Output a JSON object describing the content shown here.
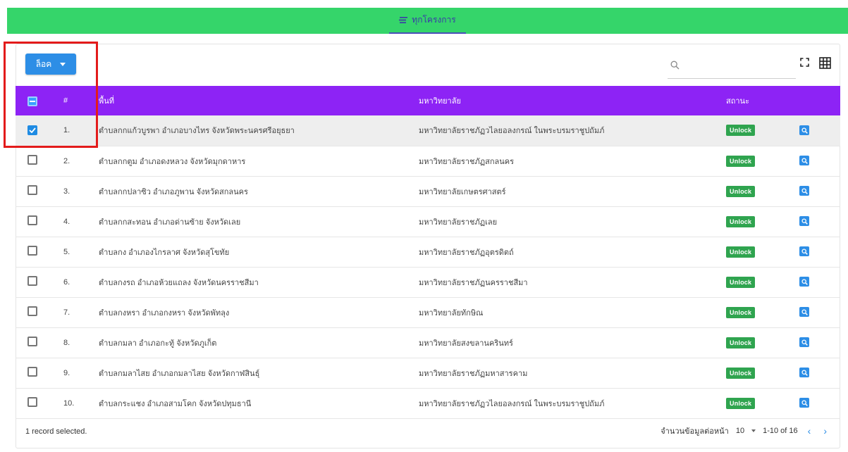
{
  "topbar": {
    "tab_label": "ทุกโครงการ"
  },
  "toolbar": {
    "lock_button_label": "ล็อค",
    "search_placeholder": ""
  },
  "table": {
    "columns": {
      "index": "#",
      "area": "พื้นที่",
      "university": "มหาวิทยาลัย",
      "status": "สถานะ"
    },
    "rows": [
      {
        "no": "1.",
        "area": "ตำบลกกแก้วบูรพา อำเภอบางไทร จังหวัดพระนครศรีอยุธยา",
        "university": "มหาวิทยาลัยราชภัฏวไลยอลงกรณ์ ในพระบรมราชูปถัมภ์",
        "status": "Unlock",
        "selected": true
      },
      {
        "no": "2.",
        "area": "ตำบลกกตูม อำเภอดงหลวง จังหวัดมุกดาหาร",
        "university": "มหาวิทยาลัยราชภัฏสกลนคร",
        "status": "Unlock",
        "selected": false
      },
      {
        "no": "3.",
        "area": "ตำบลกกปลาซิว อำเภอภูพาน จังหวัดสกลนคร",
        "university": "มหาวิทยาลัยเกษตรศาสตร์",
        "status": "Unlock",
        "selected": false
      },
      {
        "no": "4.",
        "area": "ตำบลกกสะทอน อำเภอด่านซ้าย จังหวัดเลย",
        "university": "มหาวิทยาลัยราชภัฏเลย",
        "status": "Unlock",
        "selected": false
      },
      {
        "no": "5.",
        "area": "ตำบลกง อำเภองไกรลาศ จังหวัดสุโขทัย",
        "university": "มหาวิทยาลัยราชภัฏอุตรดิตถ์",
        "status": "Unlock",
        "selected": false
      },
      {
        "no": "6.",
        "area": "ตำบลกงรถ อำเภอห้วยแถลง จังหวัดนครราชสีมา",
        "university": "มหาวิทยาลัยราชภัฏนครราชสีมา",
        "status": "Unlock",
        "selected": false
      },
      {
        "no": "7.",
        "area": "ตำบลกงหรา อำเภอกงหรา จังหวัดพัทลุง",
        "university": "มหาวิทยาลัยทักษิณ",
        "status": "Unlock",
        "selected": false
      },
      {
        "no": "8.",
        "area": "ตำบลกมลา อำเภอกะทู้ จังหวัดภูเก็ต",
        "university": "มหาวิทยาลัยสงขลานครินทร์",
        "status": "Unlock",
        "selected": false
      },
      {
        "no": "9.",
        "area": "ตำบลกมลาไสย อำเภอกมลาไสย จังหวัดกาฬสินธุ์",
        "university": "มหาวิทยาลัยราชภัฏมหาสารคาม",
        "status": "Unlock",
        "selected": false
      },
      {
        "no": "10.",
        "area": "ตำบลกระแชง อำเภอสามโคก จังหวัดปทุมธานี",
        "university": "มหาวิทยาลัยราชภัฏวไลยอลงกรณ์ ในพระบรมราชูปถัมภ์",
        "status": "Unlock",
        "selected": false
      }
    ]
  },
  "footer": {
    "selected_text": "1 record selected.",
    "rows_per_page_label": "จำนวนข้อมูลต่อหน้า",
    "rows_per_page_value": "10",
    "range_text": "1-10 of 16",
    "prev_icon": "‹",
    "next_icon": "›"
  },
  "colors": {
    "topbar": "#35d56a",
    "header": "#8d23f5",
    "primary": "#2d8ee6",
    "badge": "#2fa44f",
    "highlight": "#e31b1b"
  }
}
